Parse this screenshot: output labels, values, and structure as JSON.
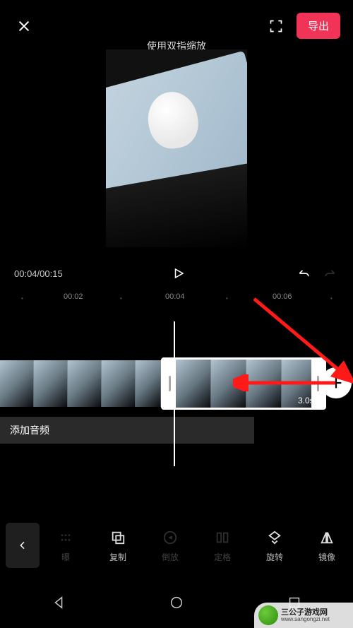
{
  "topbar": {
    "export_label": "导出"
  },
  "hint_text": "使用双指缩放",
  "playback": {
    "current": "00:04",
    "total": "00:15"
  },
  "ruler": {
    "marks": [
      "00:02",
      "00:04",
      "00:06"
    ]
  },
  "clip": {
    "duration_label": "3.0s"
  },
  "audio": {
    "add_label": "添加音频"
  },
  "tools": {
    "t0": "曝",
    "t1": "复制",
    "t2": "倒放",
    "t3": "定格",
    "t4": "旋转",
    "t5": "镜像"
  },
  "watermark": {
    "line1": "三公子游戏网",
    "line2": "www.sangongzi.net"
  },
  "colors": {
    "accent": "#f03357"
  }
}
